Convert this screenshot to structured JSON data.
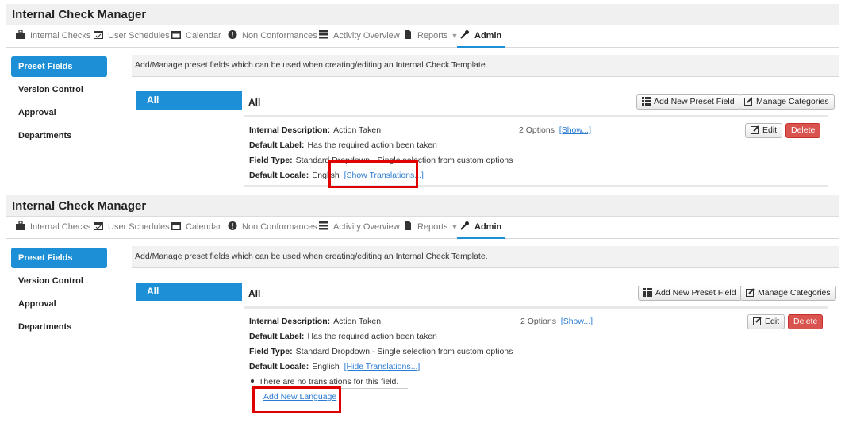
{
  "app_title": "Internal Check Manager",
  "nav": {
    "internal_checks": "Internal Checks",
    "user_schedules": "User Schedules",
    "calendar": "Calendar",
    "non_conformances": "Non Conformances",
    "activity_overview": "Activity Overview",
    "reports": "Reports",
    "admin": "Admin"
  },
  "sidebar": {
    "preset_fields": "Preset Fields",
    "version_control": "Version Control",
    "approval": "Approval",
    "departments": "Departments"
  },
  "info_text": "Add/Manage preset fields which can be used when creating/editing an Internal Check Template.",
  "category": {
    "all_tab": "All",
    "heading": "All"
  },
  "toolbar": {
    "add_preset_field": "Add New Preset Field",
    "manage_categories": "Manage Categories"
  },
  "field": {
    "internal_description_label": "Internal Description:",
    "internal_description": "Action Taken",
    "default_label_label": "Default Label:",
    "default_label": "Has the required action been taken",
    "field_type_label": "Field Type:",
    "field_type": "Standard Dropdown - Single selection from custom options",
    "default_locale_label": "Default Locale:",
    "default_locale": "English",
    "options_count": "2 Options",
    "show_options": "[Show...]",
    "edit": "Edit",
    "delete": "Delete"
  },
  "panel1": {
    "show_translations": "[Show Translations...]"
  },
  "panel2": {
    "hide_translations": "[Hide Translations...]",
    "no_translations": "There are no translations for this field.",
    "add_new_language": "Add New Language"
  },
  "colors": {
    "accent": "#1d8fd6",
    "danger": "#d9534f",
    "highlight": "#e00000"
  }
}
